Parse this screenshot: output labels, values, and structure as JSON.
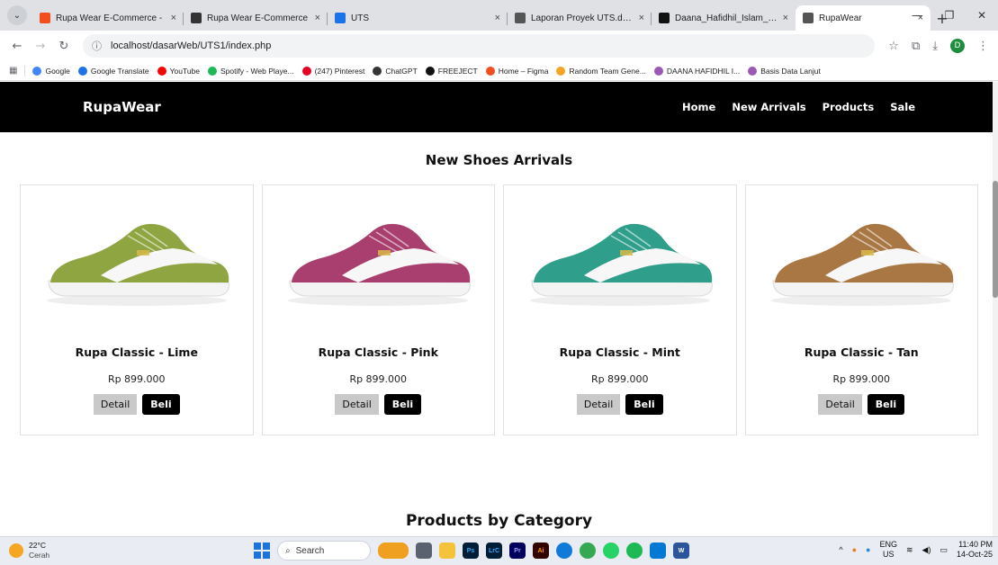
{
  "browser": {
    "tabs": [
      {
        "title": "Rupa Wear E-Commerce -",
        "favicon": "#f24e1e",
        "active": false
      },
      {
        "title": "Rupa Wear E-Commerce",
        "favicon": "#333333",
        "active": false
      },
      {
        "title": "UTS",
        "favicon": "#1a73e8",
        "active": false
      },
      {
        "title": "Laporan Proyek UTS.docx",
        "favicon": "#555555",
        "active": false
      },
      {
        "title": "Daana_Hafidhil_Islam_DESI",
        "favicon": "#111111",
        "active": false
      },
      {
        "title": "RupaWear",
        "favicon": "#555555",
        "active": true
      }
    ],
    "tab_close": "×",
    "new_tab": "+",
    "url": "localhost/dasarWeb/UTS1/index.php",
    "bookmarks": [
      {
        "label": "Google",
        "color": "#4285f4"
      },
      {
        "label": "Google Translate",
        "color": "#1a73e8"
      },
      {
        "label": "YouTube",
        "color": "#ff0000"
      },
      {
        "label": "Spotify - Web Playe...",
        "color": "#1db954"
      },
      {
        "label": "(247) Pinterest",
        "color": "#e60023"
      },
      {
        "label": "ChatGPT",
        "color": "#333333"
      },
      {
        "label": "FREEJECT",
        "color": "#111111"
      },
      {
        "label": "Home – Figma",
        "color": "#f24e1e"
      },
      {
        "label": "Random Team Gene...",
        "color": "#f5a623"
      },
      {
        "label": "DAANA HAFIDHIL I...",
        "color": "#9b59b6"
      },
      {
        "label": "Basis Data Lanjut",
        "color": "#9b59b6"
      }
    ],
    "profile_initial": "D"
  },
  "site": {
    "brand": "RupaWear",
    "nav": [
      "Home",
      "New Arrivals",
      "Products",
      "Sale"
    ],
    "section_title": "New Shoes Arrivals",
    "products": [
      {
        "name": "Rupa Classic - Lime",
        "price": "Rp 899.000",
        "color": "#8fa542"
      },
      {
        "name": "Rupa Classic - Pink",
        "price": "Rp 899.000",
        "color": "#a83f6e"
      },
      {
        "name": "Rupa Classic - Mint",
        "price": "Rp 899.000",
        "color": "#2f9e8a"
      },
      {
        "name": "Rupa Classic - Tan",
        "price": "Rp 899.000",
        "color": "#a87744"
      }
    ],
    "detail_label": "Detail",
    "buy_label": "Beli",
    "section_title_2": "Products by Category"
  },
  "taskbar": {
    "temp": "22°C",
    "condition": "Cerah",
    "search_placeholder": "Search",
    "lang_top": "ENG",
    "lang_bottom": "US",
    "time": "11:40 PM",
    "date": "14-Oct-25"
  }
}
